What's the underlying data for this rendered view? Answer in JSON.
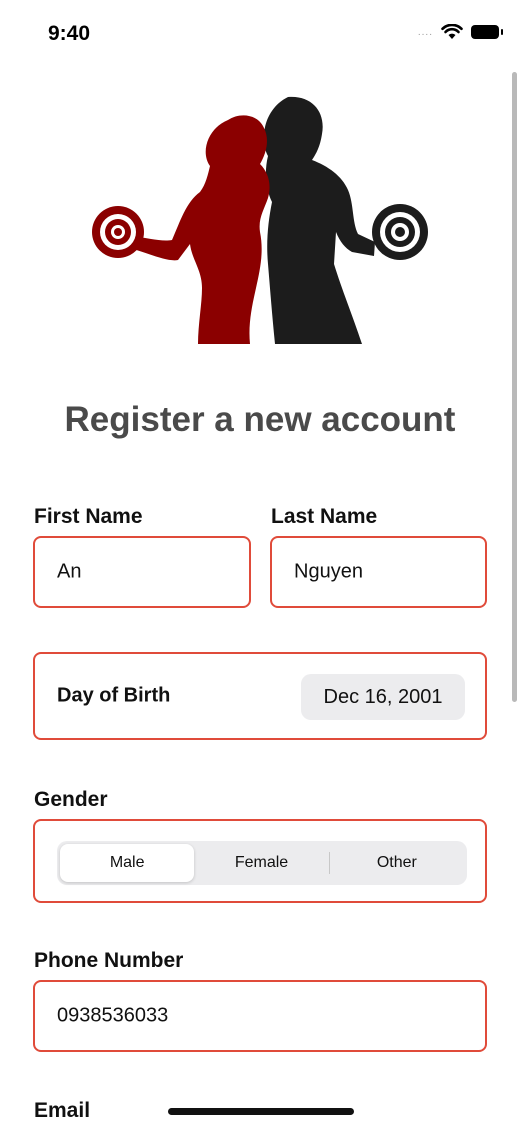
{
  "status_bar": {
    "time": "9:40",
    "signal": "....",
    "icons": [
      "cellular-dots-icon",
      "wifi-icon",
      "battery-icon"
    ]
  },
  "logo": {
    "description_icon": "fitness-couple-dumbbell-logo"
  },
  "page": {
    "title": "Register a new account"
  },
  "form": {
    "first_name": {
      "label": "First Name",
      "value": "An"
    },
    "last_name": {
      "label": "Last Name",
      "value": "Nguyen"
    },
    "dob": {
      "label": "Day of Birth",
      "value": "Dec 16, 2001"
    },
    "gender": {
      "label": "Gender",
      "options": [
        "Male",
        "Female",
        "Other"
      ],
      "selected": "Male"
    },
    "phone": {
      "label": "Phone Number",
      "value": "0938536033"
    },
    "email": {
      "label": "Email"
    }
  },
  "colors": {
    "accent": "#e04b3a",
    "title": "#4a4a4a",
    "logo_red": "#8b0000",
    "logo_black": "#1c1c1c",
    "segment_bg": "#ececee"
  }
}
